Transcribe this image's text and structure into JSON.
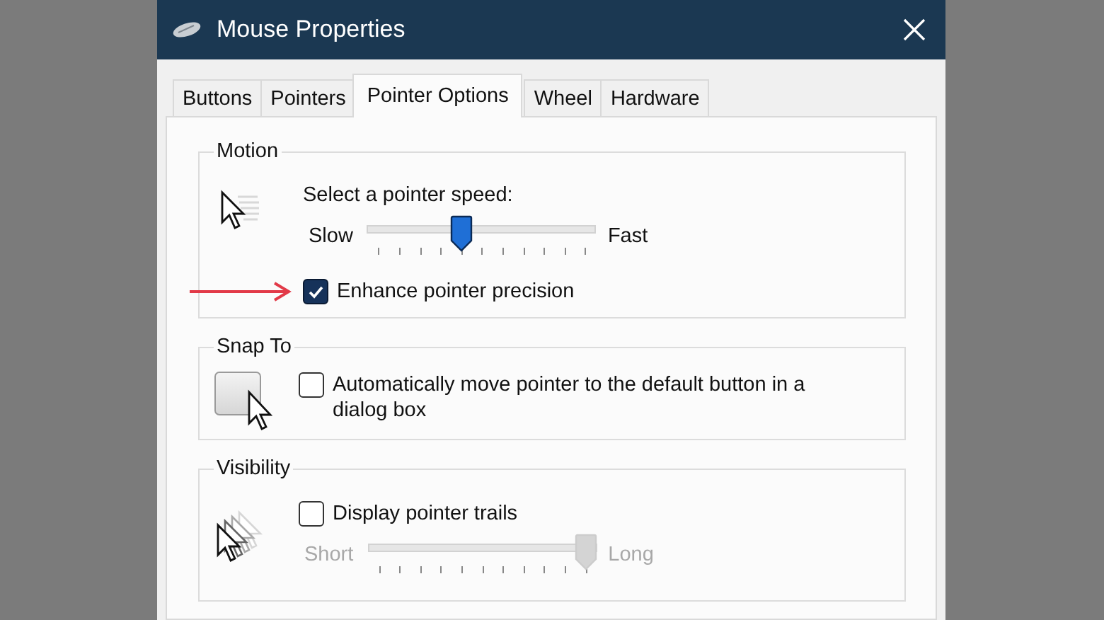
{
  "window": {
    "title": "Mouse Properties"
  },
  "tabs": [
    {
      "label": "Buttons",
      "selected": false
    },
    {
      "label": "Pointers",
      "selected": false
    },
    {
      "label": "Pointer Options",
      "selected": true
    },
    {
      "label": "Wheel",
      "selected": false
    },
    {
      "label": "Hardware",
      "selected": false
    }
  ],
  "motion": {
    "title": "Motion",
    "speed_label": "Select a pointer speed:",
    "speed_slider": {
      "min_label": "Slow",
      "max_label": "Fast",
      "level": 0.4,
      "disabled": false
    },
    "precision": {
      "label": "Enhance pointer precision",
      "checked": true
    }
  },
  "snap_to": {
    "title": "Snap To",
    "option": {
      "label": "Automatically move pointer to the default button in a dialog box",
      "checked": false
    }
  },
  "visibility": {
    "title": "Visibility",
    "trails": {
      "label": "Display pointer trails",
      "checked": false
    },
    "trails_slider": {
      "min_label": "Short",
      "max_label": "Long",
      "level": 1,
      "disabled": true
    }
  }
}
